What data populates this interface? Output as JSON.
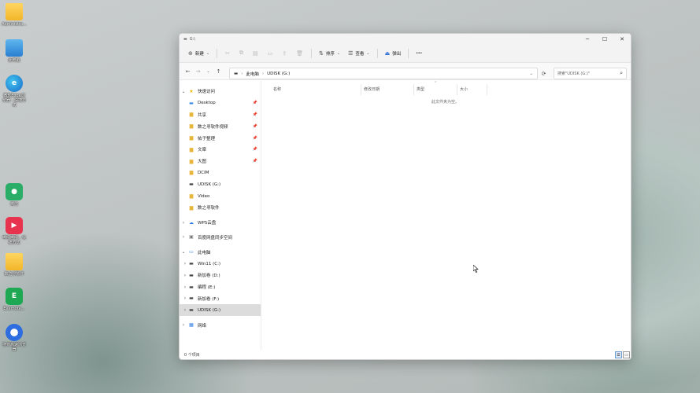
{
  "desktop": {
    "icons": [
      {
        "label": "Administra...",
        "icon": "folder-icon"
      },
      {
        "label": "此电脑",
        "icon": "computer-icon"
      },
      {
        "label": "微软Edge浏览器 - 快捷方式",
        "icon": "edge-icon"
      },
      {
        "label": "微信",
        "icon": "wechat-icon"
      },
      {
        "label": "哔哩哔哩 - 快捷方式",
        "icon": "app-icon"
      },
      {
        "label": "数之寻软件",
        "icon": "folder-icon"
      },
      {
        "label": "Evernote...",
        "icon": "evernote-icon"
      },
      {
        "label": "搜狗高速浏览器",
        "icon": "sogou-icon"
      }
    ]
  },
  "window": {
    "title": "G:\\",
    "controls": {
      "minimize": "─",
      "maximize": "☐",
      "close": "✕"
    }
  },
  "toolbar": {
    "new_label": "新建",
    "sort_label": "排序",
    "view_label": "查看",
    "eject_label": "弹出",
    "more_label": "···"
  },
  "address": {
    "crumbs": [
      "此电脑",
      "UDISK (G:)"
    ],
    "search_placeholder": "搜索\"UDISK (G:)\""
  },
  "sidebar": {
    "quick_access": "快速访问",
    "quick_items": [
      "Desktop",
      "共享",
      "数之寻软件视频",
      "帖子整理",
      "文章",
      "大图",
      "DCIM",
      "UDISK (G:)",
      "Video",
      "数之寻软件"
    ],
    "wps": "WPS云盘",
    "baidu": "百度网盘同步空间",
    "this_pc": "此电脑",
    "drives": [
      "Win11 (C:)",
      "新加卷 (D:)",
      "编程 (E:)",
      "新加卷 (F:)",
      "UDISK (G:)"
    ],
    "network": "网络"
  },
  "columns": {
    "name": "名称",
    "modified": "修改日期",
    "type": "类型",
    "size": "大小"
  },
  "empty_message": "此文件夹为空。",
  "status": {
    "item_count": "0 个项目"
  }
}
